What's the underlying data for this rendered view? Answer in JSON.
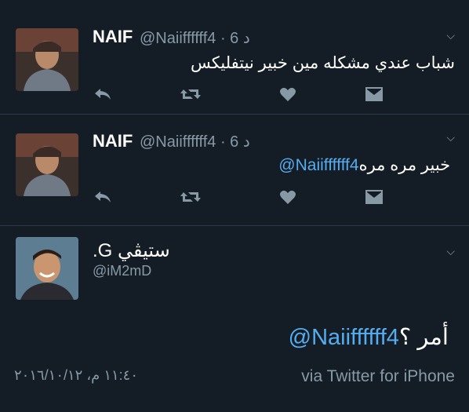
{
  "tweets": [
    {
      "name": "NAIF",
      "handle_time": "@Naiiffffff4 · 6 د",
      "text": "شباب عندي مشكله مين خبير نيتفليكس",
      "avatar_icon": "avatar-photo-icon"
    },
    {
      "name": "NAIF",
      "handle_time": "@Naiiffffff4 · 6 د",
      "mention": "@Naiiffffff4",
      "text": " خبير مره مره",
      "avatar_icon": "avatar-photo-icon"
    }
  ],
  "main_tweet": {
    "name": "ستيڤي G.",
    "handle": "@iM2mD",
    "mention": "@Naiiffffff4",
    "text": " أمر ؟",
    "timestamp": "١١:٤٠ م، ٢٠١٦/١٠/١٢",
    "via": "via Twitter for iPhone"
  },
  "colors": {
    "background": "#141d26",
    "muted": "#8899a6",
    "link": "#55acee",
    "divider": "#2b3845"
  }
}
